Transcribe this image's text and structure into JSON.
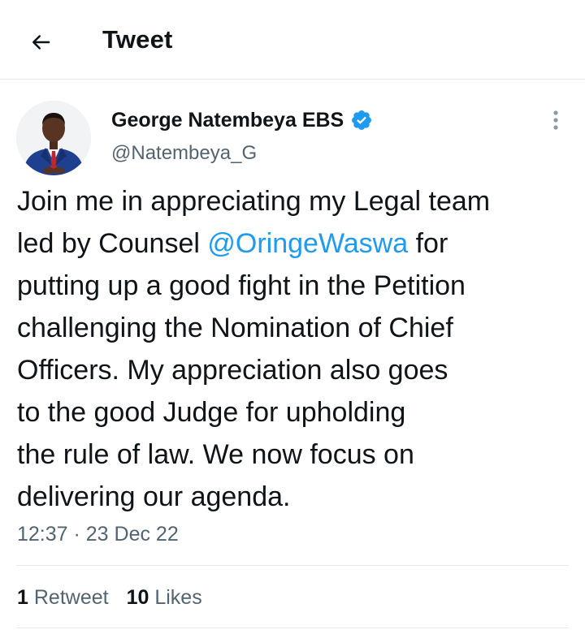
{
  "header": {
    "title": "Tweet",
    "back_icon": "arrow-left-icon"
  },
  "author": {
    "name": "George Natembeya EBS",
    "handle": "@Natembeya_G",
    "verified": true,
    "verified_icon": "verified-badge-icon",
    "verified_color": "#1d9bf0"
  },
  "more_icon": "more-vertical-icon",
  "tweet": {
    "lines": [
      [
        {
          "text": "Join me in appreciating my Legal team",
          "mention": false
        }
      ],
      [
        {
          "text": "led by Counsel ",
          "mention": false
        },
        {
          "text": "@OringeWaswa",
          "mention": true
        },
        {
          "text": " for",
          "mention": false
        }
      ],
      [
        {
          "text": "putting up a good fight in the Petition",
          "mention": false
        }
      ],
      [
        {
          "text": "challenging the Nomination of Chief",
          "mention": false
        }
      ],
      [
        {
          "text": "Officers. My appreciation also goes",
          "mention": false
        }
      ],
      [
        {
          "text": "to the good Judge for upholding",
          "mention": false
        }
      ],
      [
        {
          "text": "the rule of law. We now focus on",
          "mention": false
        }
      ],
      [
        {
          "text": "delivering our agenda.",
          "mention": false
        }
      ]
    ],
    "timestamp": "12:37 · 23 Dec 22"
  },
  "stats": {
    "retweets": {
      "count": "1",
      "label": "Retweet"
    },
    "likes": {
      "count": "10",
      "label": "Likes"
    }
  },
  "colors": {
    "text": "#0f1419",
    "secondary": "#536471",
    "link": "#1d9bf0",
    "divider": "#e6e9eb"
  }
}
